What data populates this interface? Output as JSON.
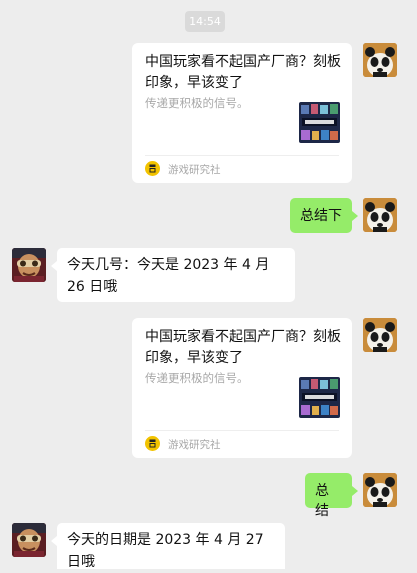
{
  "timestamp": "14:54",
  "messages": [
    {
      "card": {
        "title": "中国玩家看不起国产厂商？刻板印象，早该变了",
        "desc": "传递更积极的信号。",
        "source": "游戏研究社"
      }
    },
    {
      "text": "总结下"
    },
    {
      "text": "今天几号：今天是 2023 年 4 月 26 日哦"
    },
    {
      "card": {
        "title": "中国玩家看不起国产厂商？刻板印象，早该变了",
        "desc": "传递更积极的信号。",
        "source": "游戏研究社"
      }
    },
    {
      "text": "总结"
    },
    {
      "text": "今天的日期是 2023 年 4 月 27 日哦"
    }
  ],
  "colors": {
    "chat_bg": "#ededed",
    "sent_bubble": "#95ec69",
    "received_bubble": "#ffffff",
    "source_icon": "#f2c300"
  }
}
